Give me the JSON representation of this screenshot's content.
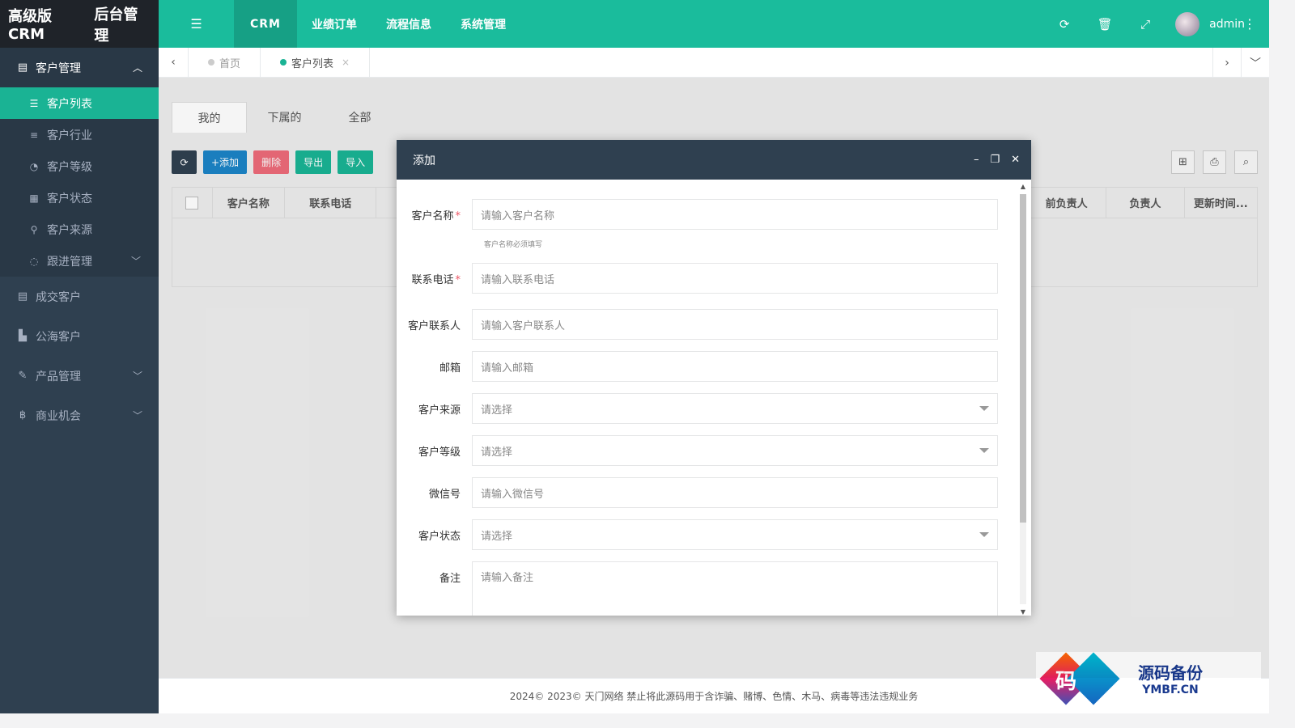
{
  "app": {
    "logo_text": "高级版CRM",
    "logo_sub": "后台管理"
  },
  "topnav": {
    "items": [
      {
        "label": "CRM"
      },
      {
        "label": "业绩订单"
      },
      {
        "label": "流程信息"
      },
      {
        "label": "系统管理"
      }
    ],
    "username": "admin"
  },
  "sidebar": {
    "customer_mgmt": "客户管理",
    "sub": [
      {
        "label": "客户列表"
      },
      {
        "label": "客户行业"
      },
      {
        "label": "客户等级"
      },
      {
        "label": "客户状态"
      },
      {
        "label": "客户来源"
      },
      {
        "label": "跟进管理"
      }
    ],
    "groups": [
      {
        "label": "成交客户"
      },
      {
        "label": "公海客户"
      },
      {
        "label": "产品管理"
      },
      {
        "label": "商业机会"
      }
    ]
  },
  "tabs": {
    "home": "首页",
    "current": "客户列表",
    "close": "×"
  },
  "subtabs": [
    "我的",
    "下属的",
    "全部"
  ],
  "toolbar": {
    "add": "+添加",
    "delete": "删除",
    "export": "导出",
    "import": "导入"
  },
  "table": {
    "headers": [
      "客户名称",
      "联系电话",
      "前负责人",
      "负责人",
      "更新时间..."
    ]
  },
  "modal": {
    "title": "添加",
    "fields": [
      {
        "label": "客户名称",
        "placeholder": "请输入客户名称",
        "required": true,
        "help": "客户名称必须填写"
      },
      {
        "label": "联系电话",
        "placeholder": "请输入联系电话",
        "required": true
      },
      {
        "label": "客户联系人",
        "placeholder": "请输入客户联系人"
      },
      {
        "label": "邮箱",
        "placeholder": "请输入邮箱"
      },
      {
        "label": "客户来源",
        "placeholder": "请选择"
      },
      {
        "label": "客户等级",
        "placeholder": "请选择"
      },
      {
        "label": "微信号",
        "placeholder": "请输入微信号"
      },
      {
        "label": "客户状态",
        "placeholder": "请选择"
      },
      {
        "label": "备注",
        "placeholder": "请输入备注"
      }
    ],
    "required_mark": "*"
  },
  "footer": {
    "text": "2024© 2023© 天门网络 禁止将此源码用于含诈骗、赌博、色情、木马、病毒等违法违规业务"
  },
  "watermark": {
    "glyph": "码",
    "title": "源码备份",
    "domain": "YMBF.CN"
  },
  "colors": {
    "accent": "#1abc9c",
    "sidebar": "#2f4050",
    "active": "#1ab394"
  }
}
